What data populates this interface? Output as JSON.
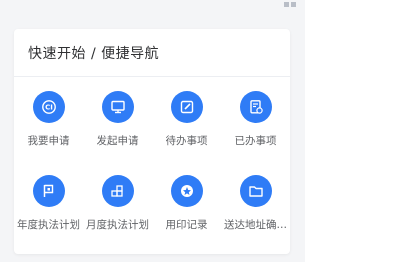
{
  "quick_nav": {
    "title": "快速开始 / 便捷导航",
    "items": [
      {
        "label": "我要申请",
        "icon": "ci-icon"
      },
      {
        "label": "发起申请",
        "icon": "monitor-icon"
      },
      {
        "label": "待办事项",
        "icon": "edit-icon"
      },
      {
        "label": "已办事项",
        "icon": "document-check-icon"
      },
      {
        "label": "年度执法计划",
        "icon": "flag-icon"
      },
      {
        "label": "月度执法计划",
        "icon": "blocks-icon"
      },
      {
        "label": "用印记录",
        "icon": "seal-icon"
      },
      {
        "label": "送达地址确…",
        "icon": "folder-icon"
      }
    ]
  },
  "colors": {
    "accent": "#2f7cf6",
    "background": "#f4f5f7",
    "card": "#ffffff"
  }
}
